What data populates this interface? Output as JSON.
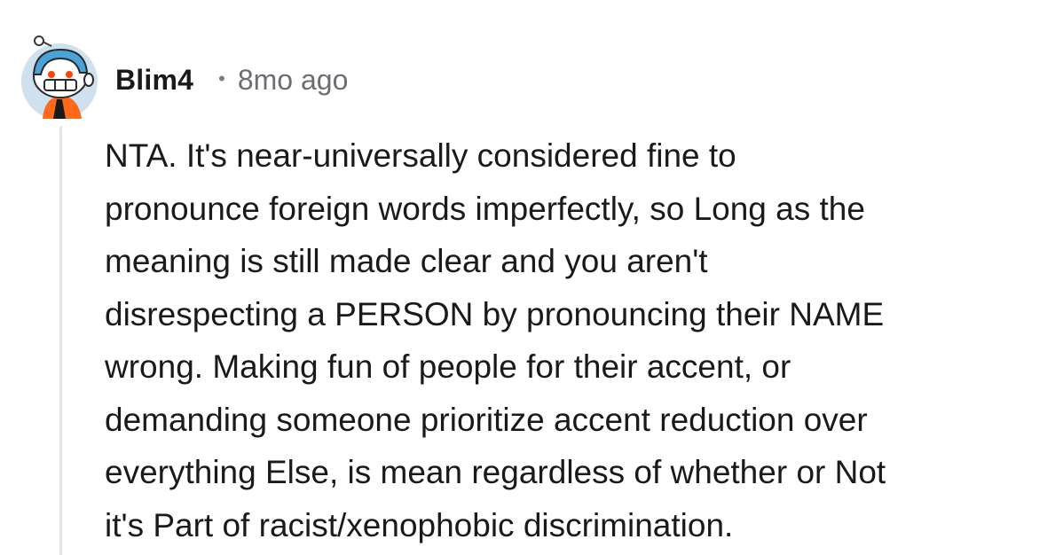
{
  "comment": {
    "author": "Blim4",
    "separator": "•",
    "timestamp": "8mo ago",
    "body": "NTA. It's near-universally considered fine to\npronounce foreign words imperfectly, so Long as the\nmeaning is still made clear and you aren't\ndisrespecting a PERSON by pronouncing their NAME\nwrong. Making fun of people for their accent, or\ndemanding someone prioritize accent reduction over\neverything Else, is mean regardless of whether or Not\nit's Part of racist/xenophobic discrimination."
  },
  "avatar": {
    "icon": "reddit-snoo-avatar-icon",
    "background_color": "#cfe0ee",
    "helmet_color": "#4aa3d8",
    "accent_color": "#ff4500"
  },
  "thread_line_color": "#e4e6e8"
}
